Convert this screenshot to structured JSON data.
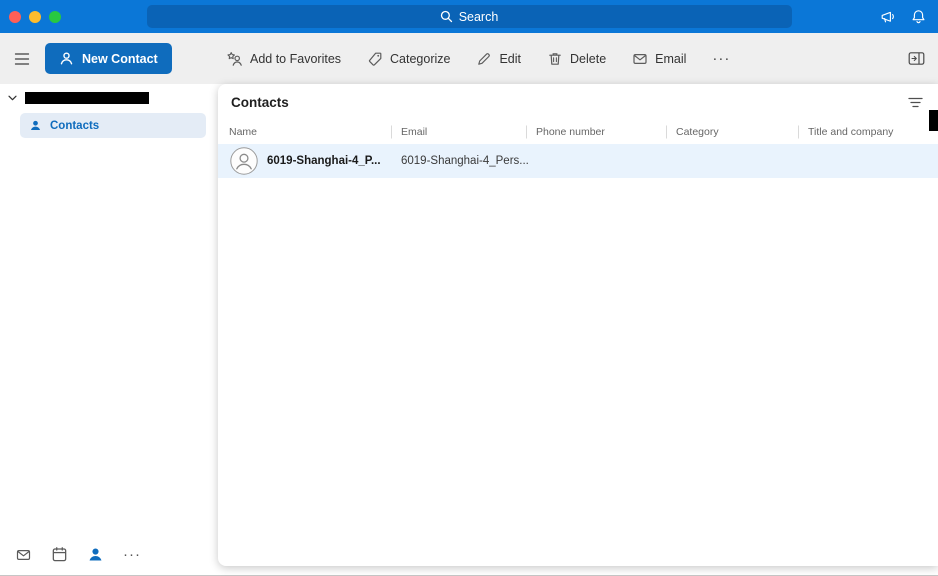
{
  "titlebar": {
    "search_placeholder": "Search"
  },
  "toolbar": {
    "new_contact": "New Contact",
    "items": [
      {
        "label": "Add to Favorites"
      },
      {
        "label": "Categorize"
      },
      {
        "label": "Edit"
      },
      {
        "label": "Delete"
      },
      {
        "label": "Email"
      }
    ],
    "more_label": "···"
  },
  "sidebar": {
    "contacts_label": "Contacts",
    "footer_more_label": "···"
  },
  "main": {
    "title": "Contacts",
    "columns": [
      "Name",
      "Email",
      "Phone number",
      "Category",
      "Title and company"
    ],
    "rows": [
      {
        "name": "6019-Shanghai-4_P...",
        "email": "6019-Shanghai-4_Pers..."
      }
    ]
  },
  "colors": {
    "titlebar_bg": "#0b77d7",
    "search_field_bg": "#0a63b6",
    "accent_blue": "#0f6cbd",
    "toolbar_bg": "#efefef",
    "selected_row_bg": "#e9f3fd",
    "sidebar_selected_bg": "#e4ecf6",
    "traffic_red": "#ff5f57",
    "traffic_yellow": "#febc2e",
    "traffic_green": "#28c840"
  }
}
